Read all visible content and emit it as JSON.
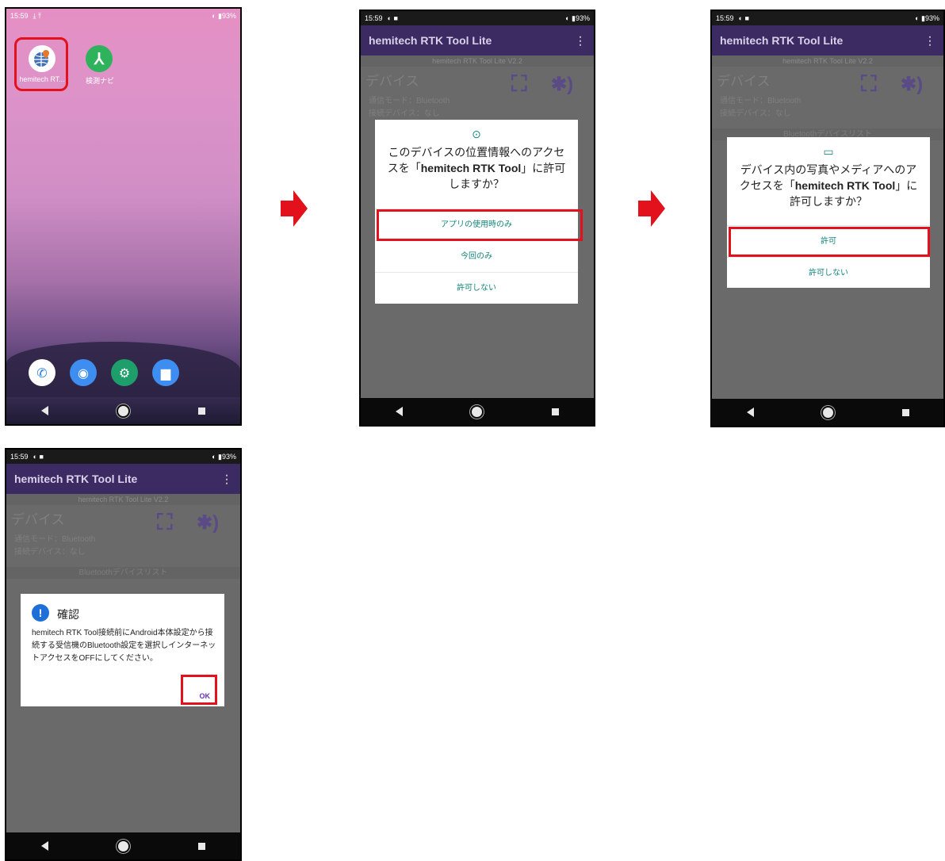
{
  "status": {
    "time": "15:59",
    "battery": "93%",
    "home_dl_icons": "⤓ ⤒"
  },
  "home": {
    "apps": [
      {
        "label": "hemitech RT..."
      },
      {
        "label": "検測ナビ"
      }
    ],
    "dock": [
      "phone-icon",
      "camera-icon",
      "settings-icon",
      "files-icon"
    ]
  },
  "app": {
    "title": "hemitech RTK Tool Lite",
    "version": "hemitech RTK Tool Lite  V2.2",
    "device_title": "デバイス",
    "comm_mode": "通信モード：Bluetooth",
    "connected": "接続デバイス：なし",
    "bt_list": "Bluetoothデバイスリスト"
  },
  "dialog_location": {
    "text_before": "このデバイスの位置情報へのアクセスを「",
    "app_name": "hemitech RTK Tool",
    "text_after": "」に許可しますか？",
    "buttons": [
      "アプリの使用時のみ",
      "今回のみ",
      "許可しない"
    ]
  },
  "dialog_media": {
    "text_before": "デバイス内の写真やメディアへのアクセスを「",
    "app_name": "hemitech RTK Tool",
    "text_after": "」に許可しますか？",
    "buttons": [
      "許可",
      "許可しない"
    ]
  },
  "dialog_confirm": {
    "title": "確認",
    "body": "hemitech RTK Tool接続前にAndroid本体設定から接続する受信機のBluetooth設定を選択しインターネットアクセスをOFFにしてください。",
    "ok": "OK"
  },
  "colors": {
    "highlight": "#e3111b",
    "arrow": "#e3111b",
    "appbar": "#3b2b62"
  }
}
